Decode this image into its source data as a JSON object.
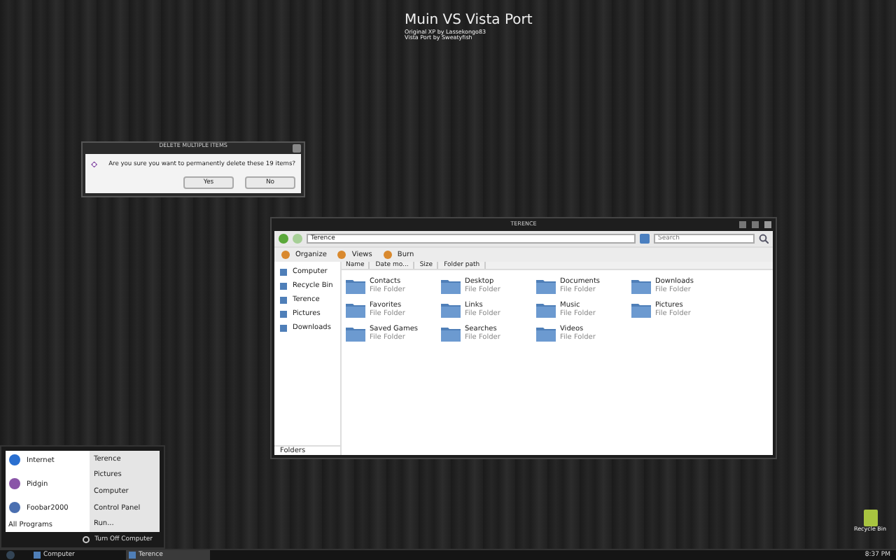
{
  "header": {
    "title": "Muin VS Vista Port",
    "credits": [
      "Original XP by Lassekongo83",
      "Vista Port by Sweatyfish"
    ]
  },
  "dialog": {
    "title": "DELETE MULTIPLE ITEMS",
    "message": "Are you sure you want to permanently delete these 19 items?",
    "buttons": [
      "Yes",
      "No"
    ]
  },
  "explorer": {
    "title": "TERENCE",
    "address": "Terence",
    "search": {
      "placeholder": "Search"
    },
    "toolbar": [
      "Organize",
      "Views",
      "Burn"
    ],
    "columns": [
      "Name",
      "Date mo...",
      "Size",
      "Folder path"
    ],
    "sidebar": {
      "items": [
        "Computer",
        "Recycle Bin",
        "Terence",
        "Pictures",
        "Downloads"
      ],
      "footer": "Folders"
    },
    "items": [
      {
        "name": "Contacts",
        "type": "File Folder"
      },
      {
        "name": "Desktop",
        "type": "File Folder"
      },
      {
        "name": "Documents",
        "type": "File Folder"
      },
      {
        "name": "Downloads",
        "type": "File Folder"
      },
      {
        "name": "Favorites",
        "type": "File Folder"
      },
      {
        "name": "Links",
        "type": "File Folder"
      },
      {
        "name": "Music",
        "type": "File Folder"
      },
      {
        "name": "Pictures",
        "type": "File Folder"
      },
      {
        "name": "Saved Games",
        "type": "File Folder"
      },
      {
        "name": "Searches",
        "type": "File Folder"
      },
      {
        "name": "Videos",
        "type": "File Folder"
      }
    ]
  },
  "start_menu": {
    "programs": [
      "Internet",
      "Pidgin",
      "Foobar2000"
    ],
    "all_programs": "All Programs",
    "places": [
      "Terence",
      "Pictures",
      "Computer",
      "Control Panel",
      "Run..."
    ],
    "turn_off": "Turn Off Computer"
  },
  "taskbar": {
    "buttons": [
      {
        "label": "Computer",
        "selected": false
      },
      {
        "label": "Terence",
        "selected": true
      }
    ],
    "clock": "8:37 PM"
  },
  "desktop_icons": [
    "Recycle Bin"
  ]
}
